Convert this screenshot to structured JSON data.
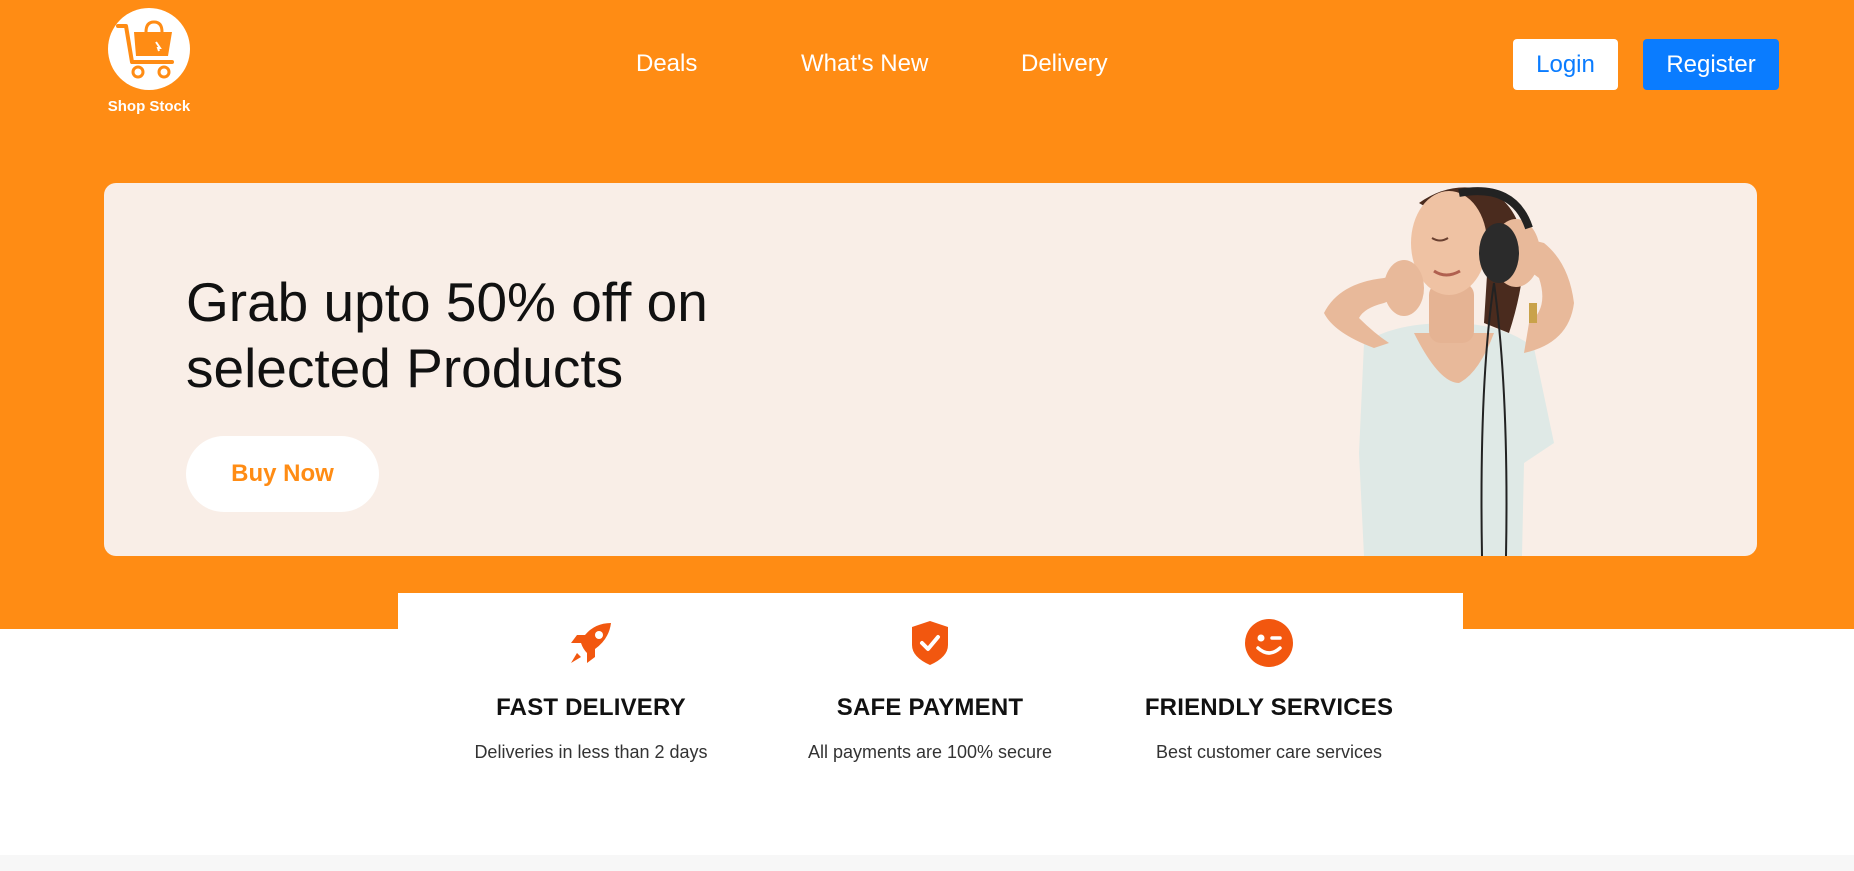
{
  "brand": {
    "name": "Shop Stock",
    "logo_icon": "shopping-cart-icon"
  },
  "nav": {
    "deals": "Deals",
    "whats_new": "What's New",
    "delivery": "Delivery"
  },
  "auth": {
    "login": "Login",
    "register": "Register"
  },
  "hero": {
    "title": "Grab upto 50% off on selected Products",
    "cta": "Buy Now",
    "image": "woman-with-headphones"
  },
  "features": [
    {
      "icon": "rocket-icon",
      "title": "FAST DELIVERY",
      "text": "Deliveries in less than 2 days"
    },
    {
      "icon": "shield-check-icon",
      "title": "SAFE PAYMENT",
      "text": "All payments are 100% secure"
    },
    {
      "icon": "wink-smile-icon",
      "title": "FRIENDLY SERVICES",
      "text": "Best customer care services"
    }
  ],
  "colors": {
    "primary_orange": "#ff8c14",
    "accent_blue": "#0a7cff",
    "icon_orange": "#f2570f",
    "hero_bg": "#f9eee7"
  }
}
